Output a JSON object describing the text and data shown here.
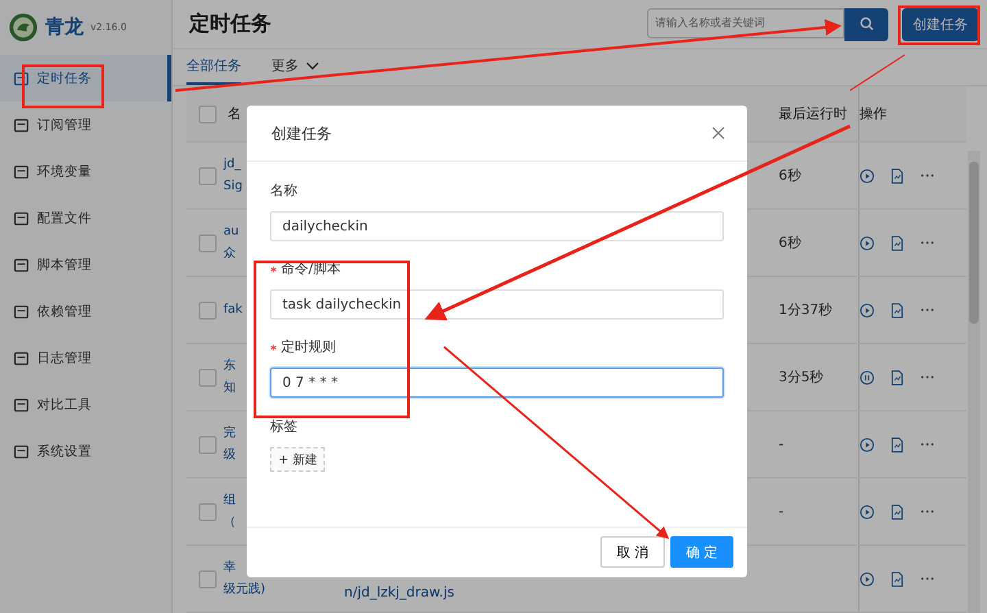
{
  "app": {
    "name": "青龙",
    "version": "v2.16.0"
  },
  "sidebar": {
    "items": [
      {
        "label": "定时任务",
        "selected": true
      },
      {
        "label": "订阅管理",
        "selected": false
      },
      {
        "label": "环境变量",
        "selected": false
      },
      {
        "label": "配置文件",
        "selected": false
      },
      {
        "label": "脚本管理",
        "selected": false
      },
      {
        "label": "依赖管理",
        "selected": false
      },
      {
        "label": "日志管理",
        "selected": false
      },
      {
        "label": "对比工具",
        "selected": false
      },
      {
        "label": "系统设置",
        "selected": false
      }
    ]
  },
  "header": {
    "title": "定时任务",
    "search": {
      "placeholder": "请输入名称或者关键词"
    },
    "create_button": "创建任务"
  },
  "tabs": [
    {
      "label": "全部任务",
      "selected": true,
      "dropdown": false
    },
    {
      "label": "更多",
      "selected": false,
      "dropdown": true
    }
  ],
  "table": {
    "columns": [
      "名",
      "最后运行时",
      "操作"
    ],
    "all_checked": false,
    "rows": [
      {
        "name_lines": [
          "jd_",
          "Sig"
        ],
        "script": "",
        "last_run": "6秒",
        "running": false,
        "checked": false
      },
      {
        "name_lines": [
          "au",
          "众"
        ],
        "script": "",
        "last_run": "6秒",
        "running": false,
        "checked": false
      },
      {
        "name_lines": [
          "fak"
        ],
        "script": "",
        "last_run": "1分37秒",
        "running": false,
        "checked": false
      },
      {
        "name_lines": [
          "东",
          "知"
        ],
        "script": "",
        "last_run": "3分5秒",
        "running": true,
        "checked": false
      },
      {
        "name_lines": [
          "完",
          "级"
        ],
        "script": "",
        "last_run": "-",
        "running": false,
        "checked": false
      },
      {
        "name_lines": [
          "组",
          "（"
        ],
        "script": "",
        "last_run": "-",
        "running": false,
        "checked": false
      },
      {
        "name_lines": [
          "幸",
          "级元践)"
        ],
        "script": "n/jd_lzkj_draw.js",
        "last_run": "",
        "running": false,
        "checked": false
      }
    ]
  },
  "dialog": {
    "title": "创建任务",
    "fields": [
      {
        "label": "名称",
        "required": false,
        "value": "dailycheckin",
        "focused": false
      },
      {
        "label": "命令/脚本",
        "required": true,
        "value": "task dailycheckin",
        "focused": false
      },
      {
        "label": "定时规则",
        "required": true,
        "value": "0 7 * * *",
        "focused": true
      }
    ],
    "tags_label": "标签",
    "new_tag_button": "+ 新建",
    "cancel_button": "取 消",
    "ok_button": "确 定"
  }
}
